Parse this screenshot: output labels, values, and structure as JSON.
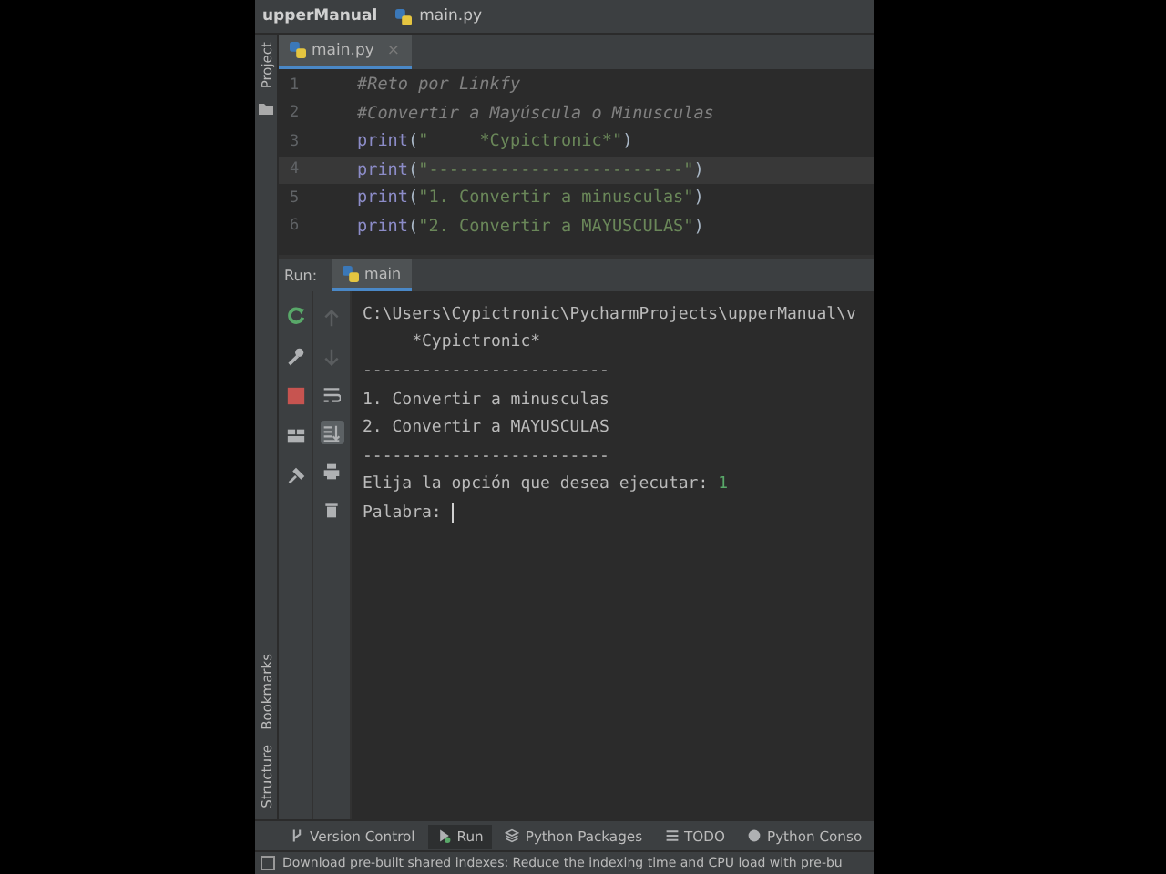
{
  "breadcrumb": {
    "project": "upperManual",
    "file": "main.py"
  },
  "side_tools": {
    "top": [
      "Project"
    ],
    "bottom": [
      "Bookmarks",
      "Structure"
    ]
  },
  "editor": {
    "tabs": [
      {
        "label": "main.py",
        "close": "×",
        "selected": true
      }
    ],
    "lines": [
      {
        "number": "1",
        "current": false,
        "tokens": [
          {
            "kind": "comment",
            "text": "#Reto por Linkfy"
          }
        ]
      },
      {
        "number": "2",
        "current": false,
        "tokens": [
          {
            "kind": "comment",
            "text": "#Convertir a Mayúscula o Minusculas"
          }
        ]
      },
      {
        "number": "3",
        "current": false,
        "tokens": [
          {
            "kind": "builtin",
            "text": "print"
          },
          {
            "kind": "plain",
            "text": "("
          },
          {
            "kind": "string",
            "text": "\"     *Cypictronic*\""
          },
          {
            "kind": "plain",
            "text": ")"
          }
        ]
      },
      {
        "number": "4",
        "current": true,
        "tokens": [
          {
            "kind": "builtin",
            "text": "print"
          },
          {
            "kind": "plain",
            "text": "("
          },
          {
            "kind": "string",
            "text": "\"-------------------------\""
          },
          {
            "kind": "plain",
            "text": ")"
          }
        ]
      },
      {
        "number": "5",
        "current": false,
        "tokens": [
          {
            "kind": "builtin",
            "text": "print"
          },
          {
            "kind": "plain",
            "text": "("
          },
          {
            "kind": "string",
            "text": "\"1. Convertir a minusculas\""
          },
          {
            "kind": "plain",
            "text": ")"
          }
        ]
      },
      {
        "number": "6",
        "current": false,
        "tokens": [
          {
            "kind": "builtin",
            "text": "print"
          },
          {
            "kind": "plain",
            "text": "("
          },
          {
            "kind": "string",
            "text": "\"2. Convertir a MAYUSCULAS\""
          },
          {
            "kind": "plain",
            "text": ")"
          }
        ]
      }
    ]
  },
  "run": {
    "label": "Run:",
    "tabs": [
      {
        "label": "main",
        "selected": true
      }
    ],
    "actions": [
      {
        "kind": "rerun"
      },
      {
        "kind": "wrench"
      },
      {
        "kind": "stop"
      },
      {
        "kind": "layout"
      },
      {
        "kind": "pin"
      }
    ],
    "console_actions": [
      {
        "kind": "up",
        "disabled": true,
        "on": false
      },
      {
        "kind": "down",
        "disabled": true,
        "on": false
      },
      {
        "kind": "wrap",
        "disabled": false,
        "on": false
      },
      {
        "kind": "scroll-end",
        "disabled": false,
        "on": true
      },
      {
        "kind": "print",
        "disabled": false,
        "on": false
      },
      {
        "kind": "trash",
        "disabled": false,
        "on": false
      }
    ],
    "console": [
      {
        "kind": "output",
        "text": "C:\\Users\\Cypictronic\\PycharmProjects\\upperManual\\v"
      },
      {
        "kind": "output",
        "text": "     *Cypictronic*"
      },
      {
        "kind": "output",
        "text": "-------------------------"
      },
      {
        "kind": "output",
        "text": "1. Convertir a minusculas"
      },
      {
        "kind": "output",
        "text": "2. Convertir a MAYUSCULAS"
      },
      {
        "kind": "output",
        "text": "-------------------------"
      },
      {
        "kind": "prompt",
        "text": "Elija la opción que desea ejecutar: ",
        "input": "1",
        "cursor": false
      },
      {
        "kind": "prompt",
        "text": "Palabra: ",
        "cursor": true
      }
    ]
  },
  "bottom_tools": [
    {
      "kind": "vcs",
      "label": "Version Control",
      "selected": false
    },
    {
      "kind": "run",
      "label": "Run",
      "selected": true
    },
    {
      "kind": "packages",
      "label": "Python Packages",
      "selected": false
    },
    {
      "kind": "todo",
      "label": "TODO",
      "selected": false
    },
    {
      "kind": "console",
      "label": "Python Conso",
      "selected": false
    }
  ],
  "status_bar": {
    "message": "Download pre-built shared indexes: Reduce the indexing time and CPU load with pre-bu"
  }
}
